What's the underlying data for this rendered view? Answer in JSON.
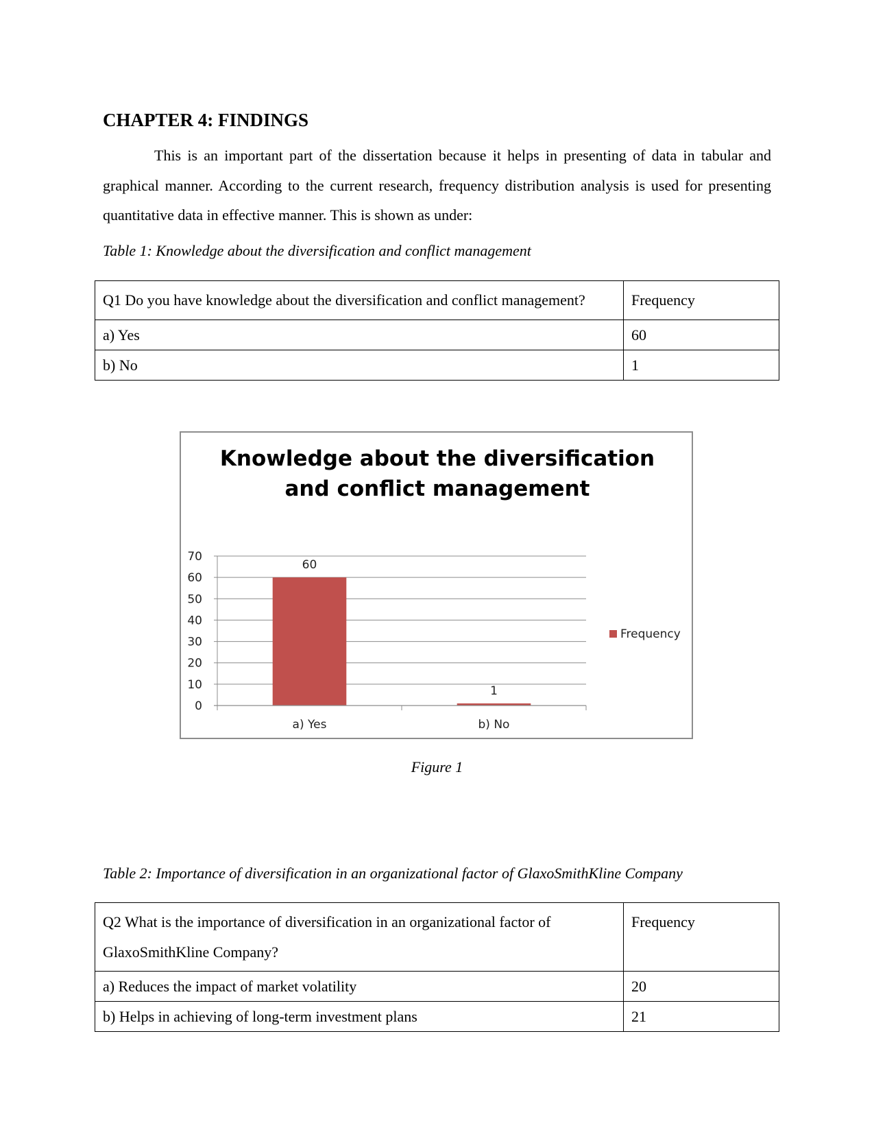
{
  "chapter_title": "CHAPTER 4: FINDINGS",
  "intro_paragraph": "This is an important part of the dissertation because it helps in presenting of data in tabular and graphical manner. According to the current research, frequency distribution analysis is used for presenting quantitative data in effective manner. This is shown as under:",
  "table1": {
    "caption": "Table 1: Knowledge about the diversification and conflict management",
    "header": {
      "question": "Q1 Do you have knowledge about the diversification and conflict management?",
      "frequency": "Frequency"
    },
    "rows": [
      {
        "option": "a) Yes",
        "frequency": "60"
      },
      {
        "option": "b) No",
        "frequency": "1"
      }
    ]
  },
  "figure1": {
    "caption": "Figure 1"
  },
  "chart_data": {
    "type": "bar",
    "title": "Knowledge about the diversification and conflict management",
    "title_lines": [
      "Knowledge about the diversification",
      "and conflict management"
    ],
    "categories": [
      "a) Yes",
      "b) No"
    ],
    "series": [
      {
        "name": "Frequency",
        "values": [
          60,
          1
        ],
        "color": "#c0504d"
      }
    ],
    "data_labels": [
      "60",
      "1"
    ],
    "xlabel": "",
    "ylabel": "",
    "ylim": [
      0,
      70
    ],
    "yticks": [
      0,
      10,
      20,
      30,
      40,
      50,
      60,
      70
    ],
    "grid": true,
    "legend": {
      "position": "right",
      "entries": [
        "Frequency"
      ]
    },
    "gridline_color": "#8c8c8c"
  },
  "table2": {
    "caption": "Table 2: Importance of diversification in an organizational factor of GlaxoSmithKline Company",
    "header": {
      "question": "Q2 What is the importance of diversification in an organizational factor of GlaxoSmithKline Company?",
      "frequency": "Frequency"
    },
    "rows": [
      {
        "option": "a) Reduces the impact of market volatility",
        "frequency": "20"
      },
      {
        "option": "b) Helps in achieving of long-term investment plans",
        "frequency": "21"
      }
    ]
  }
}
